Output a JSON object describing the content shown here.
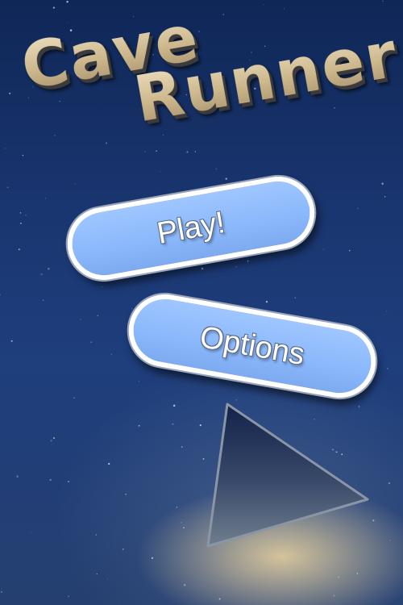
{
  "game": {
    "title_line1": "Cave",
    "title_line2": "Runner"
  },
  "menu": {
    "play_label": "Play!",
    "options_label": "Options"
  },
  "colors": {
    "background": "#1a3670",
    "button_fill": "#8ab8fb",
    "button_border": "#ffffff",
    "title_gold": "#d9c9a3",
    "glow": "#f0d7a0"
  },
  "icons": {
    "play_triangle": "play-triangle-icon"
  }
}
